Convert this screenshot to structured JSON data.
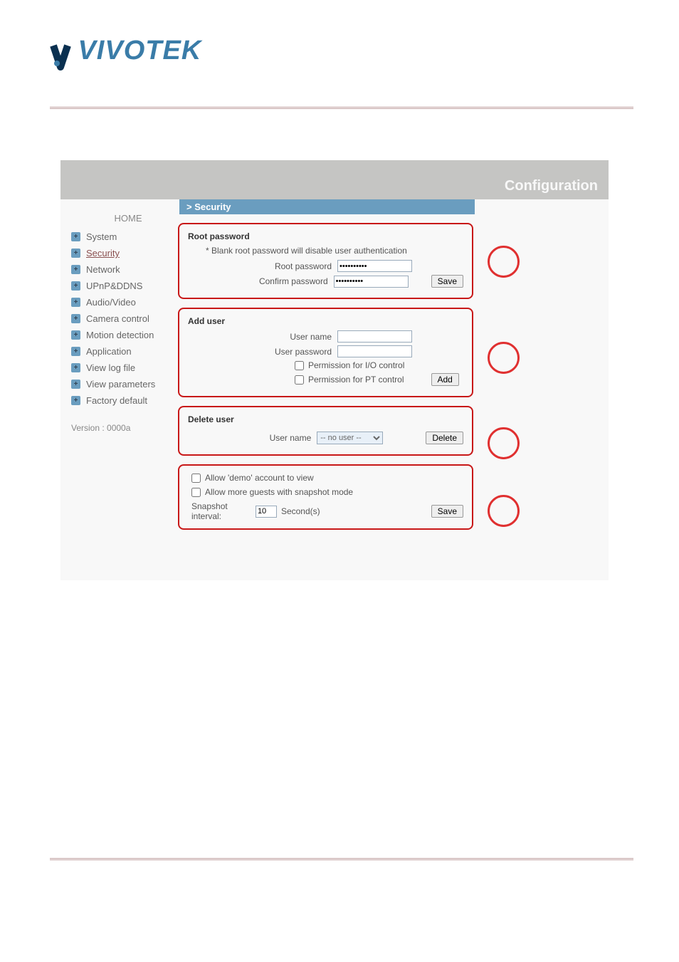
{
  "logo": {
    "text": "VIVOTEK"
  },
  "header": {
    "title": "Configuration"
  },
  "section_header": "> Security",
  "nav": {
    "home": "HOME",
    "items": [
      {
        "label": "System"
      },
      {
        "label": "Security"
      },
      {
        "label": "Network"
      },
      {
        "label": "UPnP&DDNS"
      },
      {
        "label": "Audio/Video"
      },
      {
        "label": "Camera control"
      },
      {
        "label": "Motion detection"
      },
      {
        "label": "Application"
      },
      {
        "label": "View log file"
      },
      {
        "label": "View parameters"
      },
      {
        "label": "Factory default"
      }
    ],
    "version": "Version : 0000a"
  },
  "panels": {
    "root_password": {
      "title": "Root password",
      "note": "* Blank root password will disable user authentication",
      "root_label": "Root password",
      "confirm_label": "Confirm password",
      "root_value": "••••••••••",
      "confirm_value": "••••••••••",
      "save_btn": "Save"
    },
    "add_user": {
      "title": "Add user",
      "username_label": "User name",
      "password_label": "User password",
      "perm_io": "Permission for I/O control",
      "perm_pt": "Permission for PT control",
      "add_btn": "Add"
    },
    "delete_user": {
      "title": "Delete user",
      "username_label": "User name",
      "select_value": "-- no user --",
      "delete_btn": "Delete"
    },
    "demo": {
      "allow_demo": "Allow 'demo' account to view",
      "allow_guests": "Allow more guests with snapshot mode",
      "snapshot_label": "Snapshot interval:",
      "snapshot_value": "10",
      "seconds": "Second(s)",
      "save_btn": "Save"
    }
  }
}
